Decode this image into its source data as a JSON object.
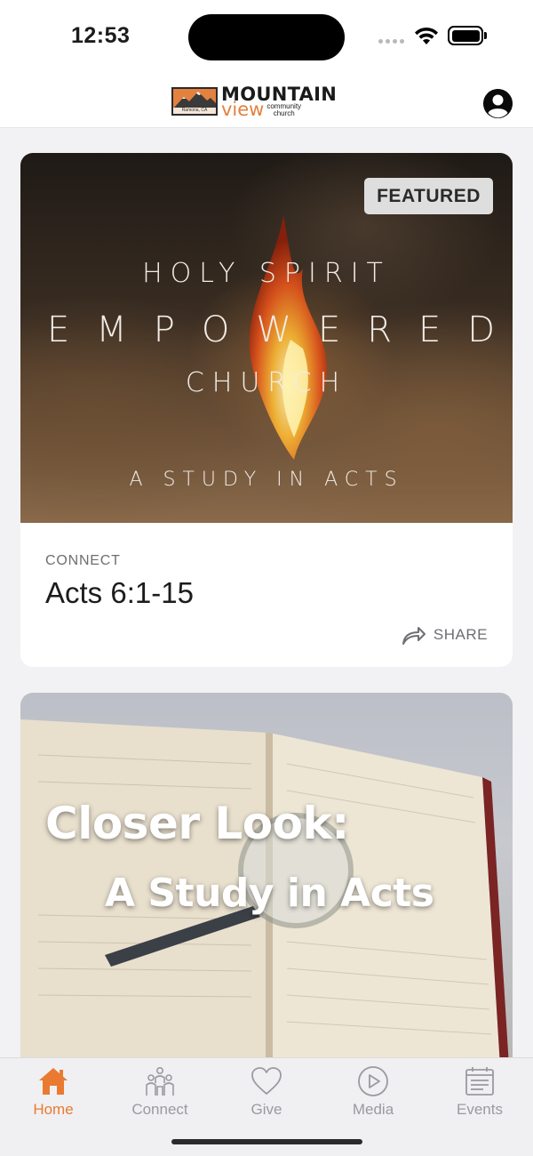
{
  "status_bar": {
    "time": "12:53"
  },
  "header": {
    "logo": {
      "word_top": "MOUNTAIN",
      "word_bottom": "view",
      "tagline_1": "community",
      "tagline_2": "church",
      "location": "Ramona, CA"
    },
    "profile_icon": "person-circle-icon"
  },
  "cards": [
    {
      "badge": "FEATURED",
      "hero_lines": [
        "HOLY SPIRIT",
        "EMPOWERED",
        "CHURCH",
        "A STUDY IN ACTS"
      ],
      "category": "CONNECT",
      "title": "Acts 6:1-15",
      "share_label": "SHARE",
      "share_icon": "share-arrow-icon"
    },
    {
      "hero_lines": [
        "Closer Look:",
        "A Study in Acts"
      ]
    }
  ],
  "tabbar": {
    "active_color": "#ea7a32",
    "items": [
      {
        "label": "Home",
        "icon": "home-icon",
        "active": true
      },
      {
        "label": "Connect",
        "icon": "people-icon",
        "active": false
      },
      {
        "label": "Give",
        "icon": "heart-icon",
        "active": false
      },
      {
        "label": "Media",
        "icon": "play-circle-icon",
        "active": false
      },
      {
        "label": "Events",
        "icon": "calendar-icon",
        "active": false
      }
    ]
  }
}
